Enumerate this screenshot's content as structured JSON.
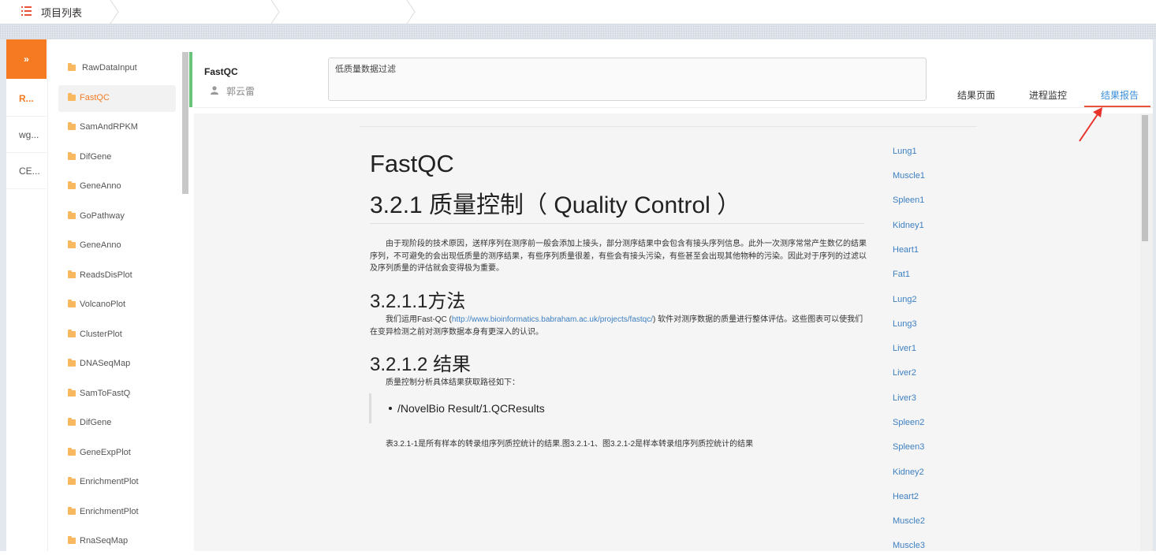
{
  "breadcrumb": {
    "title": "项目列表"
  },
  "sidebar": {
    "toggle": "»",
    "items": [
      {
        "label": "R...",
        "active": true
      },
      {
        "label": "wg..."
      },
      {
        "label": "CE..."
      }
    ]
  },
  "modules": [
    {
      "label": "RawDataInput"
    },
    {
      "label": "FastQC",
      "active": true
    },
    {
      "label": "SamAndRPKM"
    },
    {
      "label": "DifGene"
    },
    {
      "label": "GeneAnno"
    },
    {
      "label": "GoPathway"
    },
    {
      "label": "GeneAnno"
    },
    {
      "label": "ReadsDisPlot"
    },
    {
      "label": "VolcanoPlot"
    },
    {
      "label": "ClusterPlot"
    },
    {
      "label": "DNASeqMap"
    },
    {
      "label": "SamToFastQ"
    },
    {
      "label": "DifGene"
    },
    {
      "label": "GeneExpPlot"
    },
    {
      "label": "EnrichmentPlot"
    },
    {
      "label": "EnrichmentPlot"
    },
    {
      "label": "RnaSeqMap"
    }
  ],
  "project": {
    "name": "FastQC",
    "user": "郭云雷",
    "description": "低质量数据过滤"
  },
  "tabs": [
    {
      "label": "结果页面"
    },
    {
      "label": "进程监控"
    },
    {
      "label": "结果报告",
      "active": true
    }
  ],
  "report": {
    "title": "FastQC",
    "section": "3.2.1 质量控制（ Quality Control ）",
    "intro": "由于现阶段的技术原因，送样序列在测序前一般会添加上接头，部分测序结果中会包含有接头序列信息。此外一次测序常常产生数亿的结果序列，不可避免的会出现低质量的测序结果，有些序列质量很差，有些会有接头污染，有些甚至会出现其他物种的污染。因此对于序列的过滤以及序列质量的评估就会变得极为重要。",
    "method_heading": "3.2.1.1方法",
    "method_pre": "我们运用Fast-QC (",
    "method_link": "http://www.bioinformatics.babraham.ac.uk/projects/fastqc/",
    "method_post": ") 软件对测序数据的质量进行整体评估。这些图表可以使我们在变异检测之前对测序数据本身有更深入的认识。",
    "result_heading": "3.2.1.2 结果",
    "result_text": "质量控制分析具体结果获取路径如下：",
    "result_path": "/NovelBio Result/1.QCResults",
    "table_note": "表3.2.1-1是所有样本的转录组序列质控统计的结果.图3.2.1-1、图3.2.1-2是样本转录组序列质控统计的结果"
  },
  "toc": [
    "Lung1",
    "Muscle1",
    "Spleen1",
    "Kidney1",
    "Heart1",
    "Fat1",
    "Lung2",
    "Lung3",
    "Liver1",
    "Liver2",
    "Liver3",
    "Spleen2",
    "Spleen3",
    "Kidney2",
    "Heart2",
    "Muscle2",
    "Muscle3"
  ],
  "colors": {
    "accent": "#f57a22",
    "link": "#3d7fc1",
    "tab_active": "#3d8fd9",
    "underline": "#e8533a",
    "green": "#69c37a"
  }
}
